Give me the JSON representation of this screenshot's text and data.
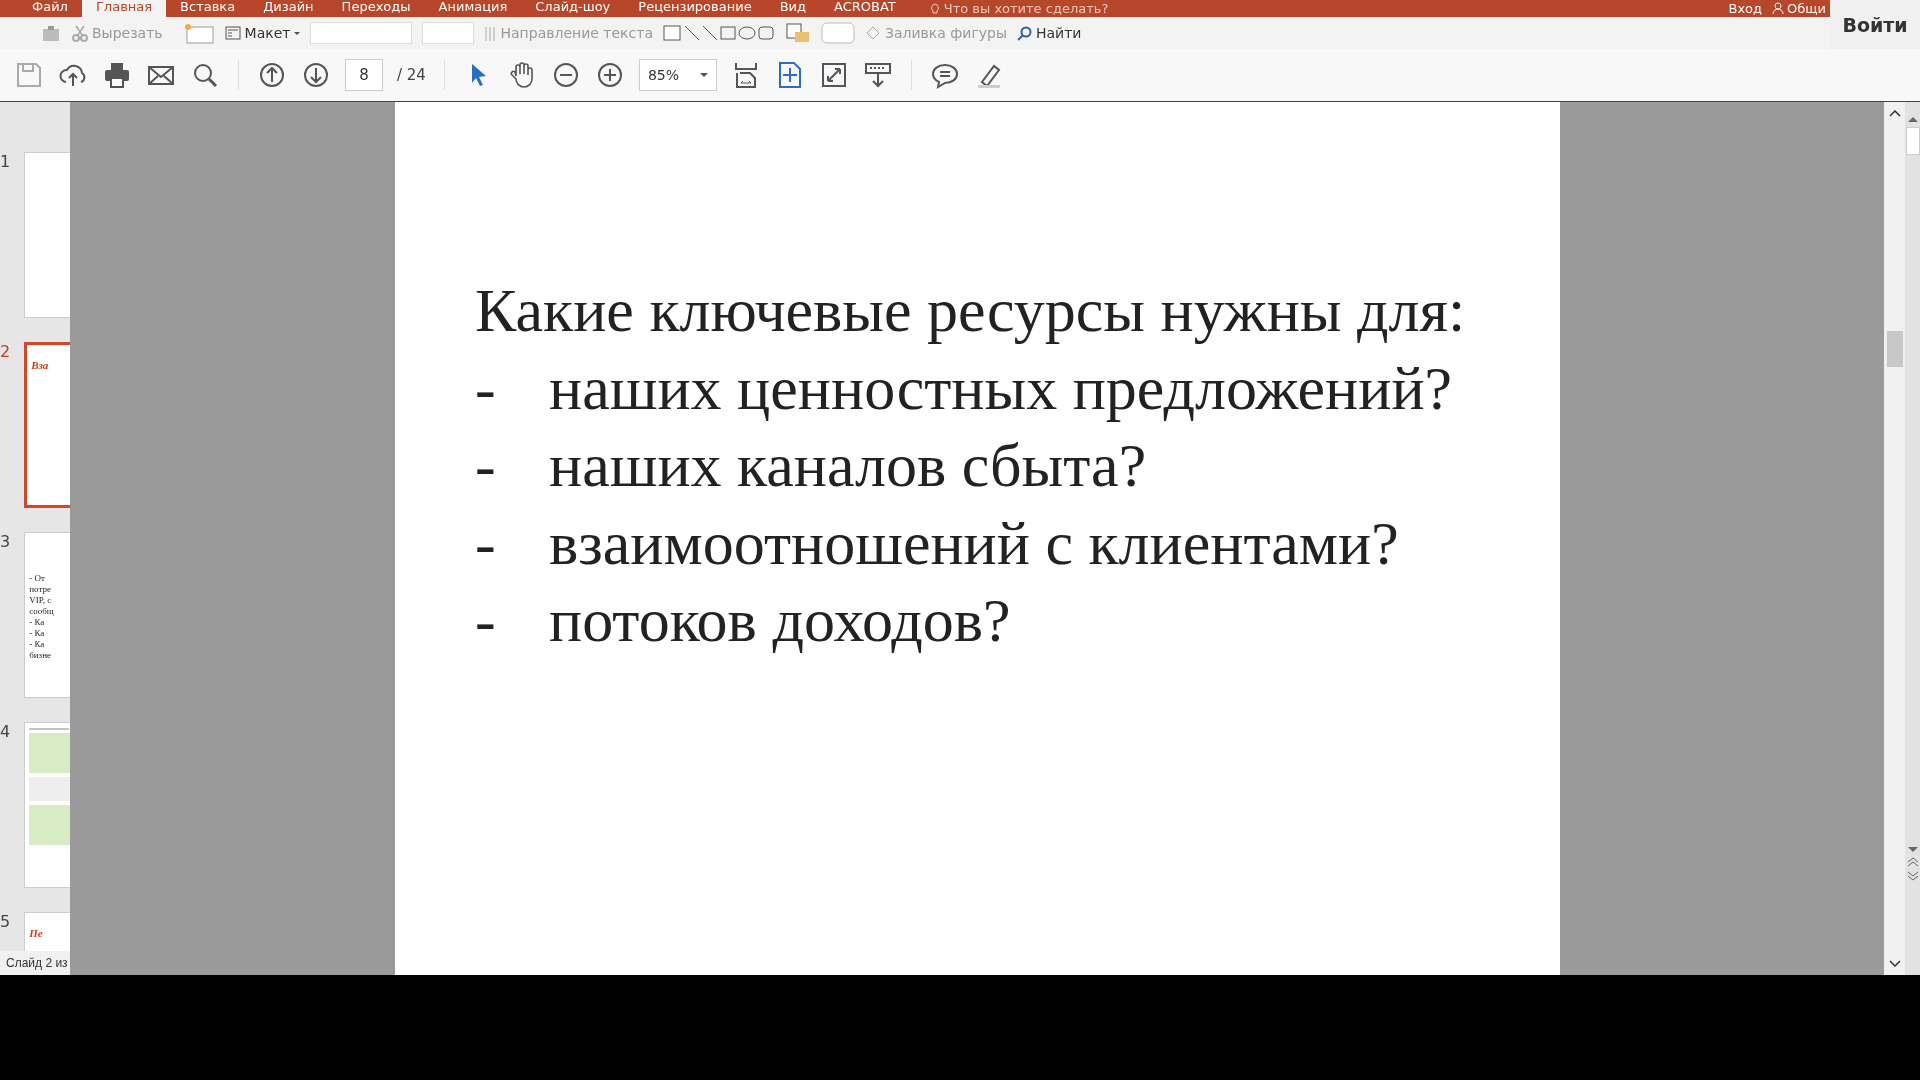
{
  "ribbon_tabs": [
    {
      "label": "Файл",
      "selected": false
    },
    {
      "label": "Главная",
      "selected": true
    },
    {
      "label": "Вставка",
      "selected": false
    },
    {
      "label": "Дизайн",
      "selected": false
    },
    {
      "label": "Переходы",
      "selected": false
    },
    {
      "label": "Анимация",
      "selected": false
    },
    {
      "label": "Слайд-шоу",
      "selected": false
    },
    {
      "label": "Рецензирование",
      "selected": false
    },
    {
      "label": "Вид",
      "selected": false
    },
    {
      "label": "ACROBAT",
      "selected": false
    }
  ],
  "tell_me": "Что вы хотите сделать?",
  "account": {
    "sign_in": "Вход",
    "share": "Общи"
  },
  "login_button": "Войти",
  "ribbon": {
    "cut": "Вырезать",
    "layout": "Макет",
    "text_direction": "Направление текста",
    "shape_fill": "Заливка фигуры",
    "find": "Найти"
  },
  "pdf_toolbar": {
    "page": "8",
    "page_count": "/ 24",
    "zoom": "85%"
  },
  "thumbnails": [
    {
      "number": "1",
      "kind": "blank",
      "selected": false
    },
    {
      "number": "2",
      "kind": "title",
      "title": "Вза",
      "selected": true
    },
    {
      "number": "3",
      "kind": "text",
      "lines": [
        "- От",
        "потре",
        "VIP, с",
        "сообщ",
        "- Ка",
        "- Ка",
        "- Ка",
        "бизне"
      ],
      "selected": false
    },
    {
      "number": "4",
      "kind": "table",
      "selected": false
    },
    {
      "number": "5",
      "kind": "title",
      "title": "Пе",
      "selected": false
    }
  ],
  "status_bar": "Слайд 2 из",
  "slide": {
    "heading": "Какие ключевые ресурсы нужны для:",
    "bullets": [
      {
        "marker": "-",
        "text": "наших ценностных предложений?"
      },
      {
        "marker": "-",
        "text": "наших каналов сбыта?"
      },
      {
        "marker": "-",
        "text": "взаимоотношений с клиентами?"
      },
      {
        "marker": "-",
        "text": "потоков доходов?"
      }
    ]
  }
}
